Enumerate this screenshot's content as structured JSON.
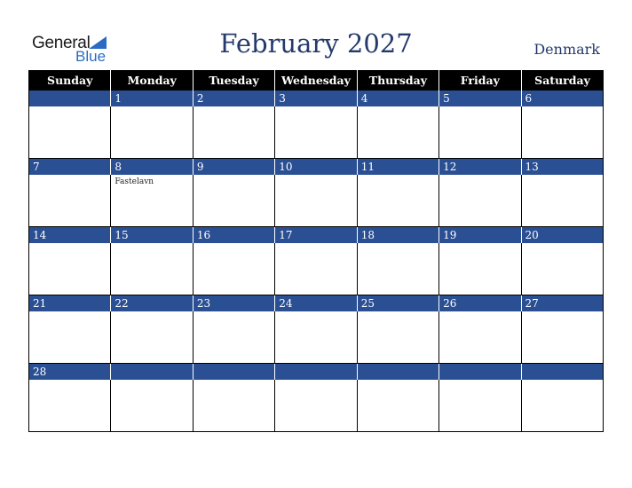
{
  "logo": {
    "general": "General",
    "blue": "Blue"
  },
  "title": "February 2027",
  "country": "Denmark",
  "colors": {
    "header_bg": "#000000",
    "date_bar": "#2b4f93",
    "title": "#243a6b",
    "logo_blue": "#2a6cc4"
  },
  "weekdays": [
    "Sunday",
    "Monday",
    "Tuesday",
    "Wednesday",
    "Thursday",
    "Friday",
    "Saturday"
  ],
  "weeks": [
    {
      "days": [
        "",
        "1",
        "2",
        "3",
        "4",
        "5",
        "6"
      ],
      "events": [
        "",
        "",
        "",
        "",
        "",
        "",
        ""
      ]
    },
    {
      "days": [
        "7",
        "8",
        "9",
        "10",
        "11",
        "12",
        "13"
      ],
      "events": [
        "",
        "Fastelavn",
        "",
        "",
        "",
        "",
        ""
      ]
    },
    {
      "days": [
        "14",
        "15",
        "16",
        "17",
        "18",
        "19",
        "20"
      ],
      "events": [
        "",
        "",
        "",
        "",
        "",
        "",
        ""
      ]
    },
    {
      "days": [
        "21",
        "22",
        "23",
        "24",
        "25",
        "26",
        "27"
      ],
      "events": [
        "",
        "",
        "",
        "",
        "",
        "",
        ""
      ]
    },
    {
      "days": [
        "28",
        "",
        "",
        "",
        "",
        "",
        ""
      ],
      "events": [
        "",
        "",
        "",
        "",
        "",
        "",
        ""
      ]
    }
  ]
}
